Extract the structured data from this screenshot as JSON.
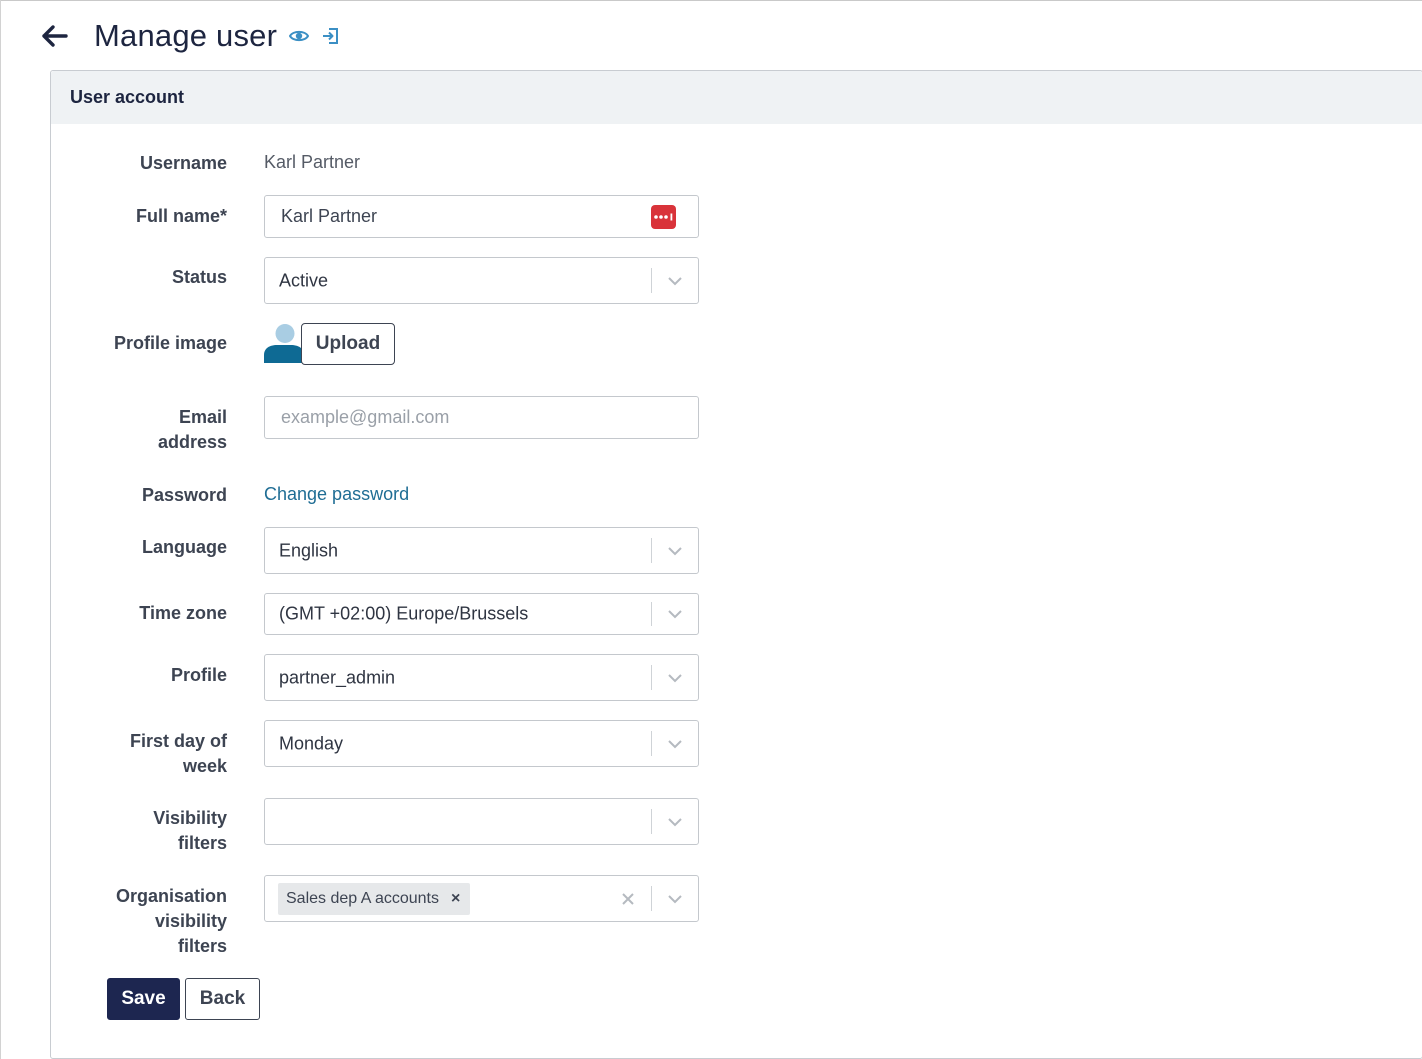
{
  "header": {
    "title": "Manage user",
    "icons": {
      "back": "back-arrow-icon",
      "view": "eye-icon",
      "login_as": "login-icon"
    }
  },
  "card": {
    "title": "User account"
  },
  "form": {
    "username": {
      "label": "Username",
      "value": "Karl Partner"
    },
    "full_name": {
      "label": "Full name*",
      "value": "Karl Partner",
      "placeholder": ""
    },
    "status": {
      "label": "Status",
      "value": "Active"
    },
    "profile_image": {
      "label": "Profile image",
      "upload_label": "Upload"
    },
    "email": {
      "label_line1": "Email",
      "label_line2": "address",
      "value": "",
      "placeholder": "example@gmail.com"
    },
    "password": {
      "label": "Password",
      "link": "Change password"
    },
    "language": {
      "label": "Language",
      "value": "English"
    },
    "time_zone": {
      "label": "Time zone",
      "value": "(GMT +02:00) Europe/Brussels"
    },
    "profile": {
      "label": "Profile",
      "value": "partner_admin"
    },
    "first_day": {
      "label_line1": "First day of",
      "label_line2": "week",
      "value": "Monday"
    },
    "visibility_filters": {
      "label_line1": "Visibility",
      "label_line2": "filters",
      "value": ""
    },
    "org_visibility_filters": {
      "label_line1": "Organisation",
      "label_line2": "visibility",
      "label_line3": "filters",
      "tags": [
        "Sales dep A accounts"
      ],
      "tag_remove": "×"
    }
  },
  "actions": {
    "save": "Save",
    "back": "Back"
  },
  "colors": {
    "primary": "#1d2650",
    "link": "#1f6d94",
    "accent_icon": "#3b8fc4",
    "pw_manager": "#d9333a",
    "avatar": "#0e6a94",
    "avatar_head": "#a9cde3"
  }
}
